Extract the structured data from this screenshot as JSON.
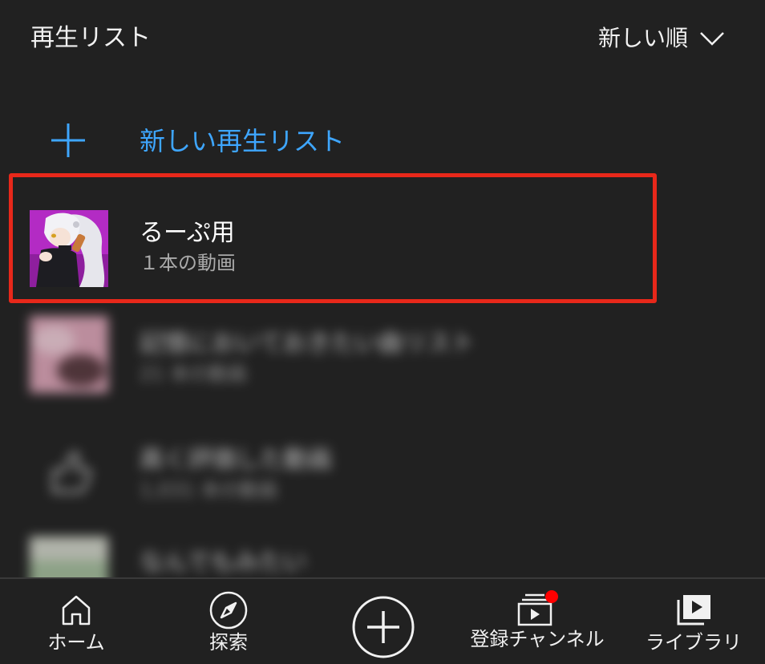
{
  "header": {
    "title": "再生リスト",
    "sort_label": "新しい順"
  },
  "new_playlist": {
    "label": "新しい再生リスト"
  },
  "playlists": [
    {
      "title": "るーぷ用",
      "subtitle": "１本の動画",
      "blurred": false
    },
    {
      "title": "記憶においておきたい曲リスト",
      "subtitle": "21 本の動画",
      "blurred": true
    },
    {
      "title": "高く評価した動画",
      "subtitle": "1,031 本の動画",
      "blurred": true
    },
    {
      "title": "なんでもみたい",
      "subtitle": "",
      "blurred": true
    }
  ],
  "bottom_nav": {
    "items": [
      {
        "label": "ホーム",
        "icon": "home-icon"
      },
      {
        "label": "探索",
        "icon": "compass-icon"
      },
      {
        "label": "",
        "icon": "create-plus-icon"
      },
      {
        "label": "登録チャンネル",
        "icon": "subscriptions-icon"
      },
      {
        "label": "ライブラリ",
        "icon": "library-icon"
      }
    ]
  },
  "colors": {
    "background": "#212121",
    "accent_blue": "#3ea6ff",
    "highlight_red": "#e8281a",
    "notification_dot": "#ff0000"
  }
}
